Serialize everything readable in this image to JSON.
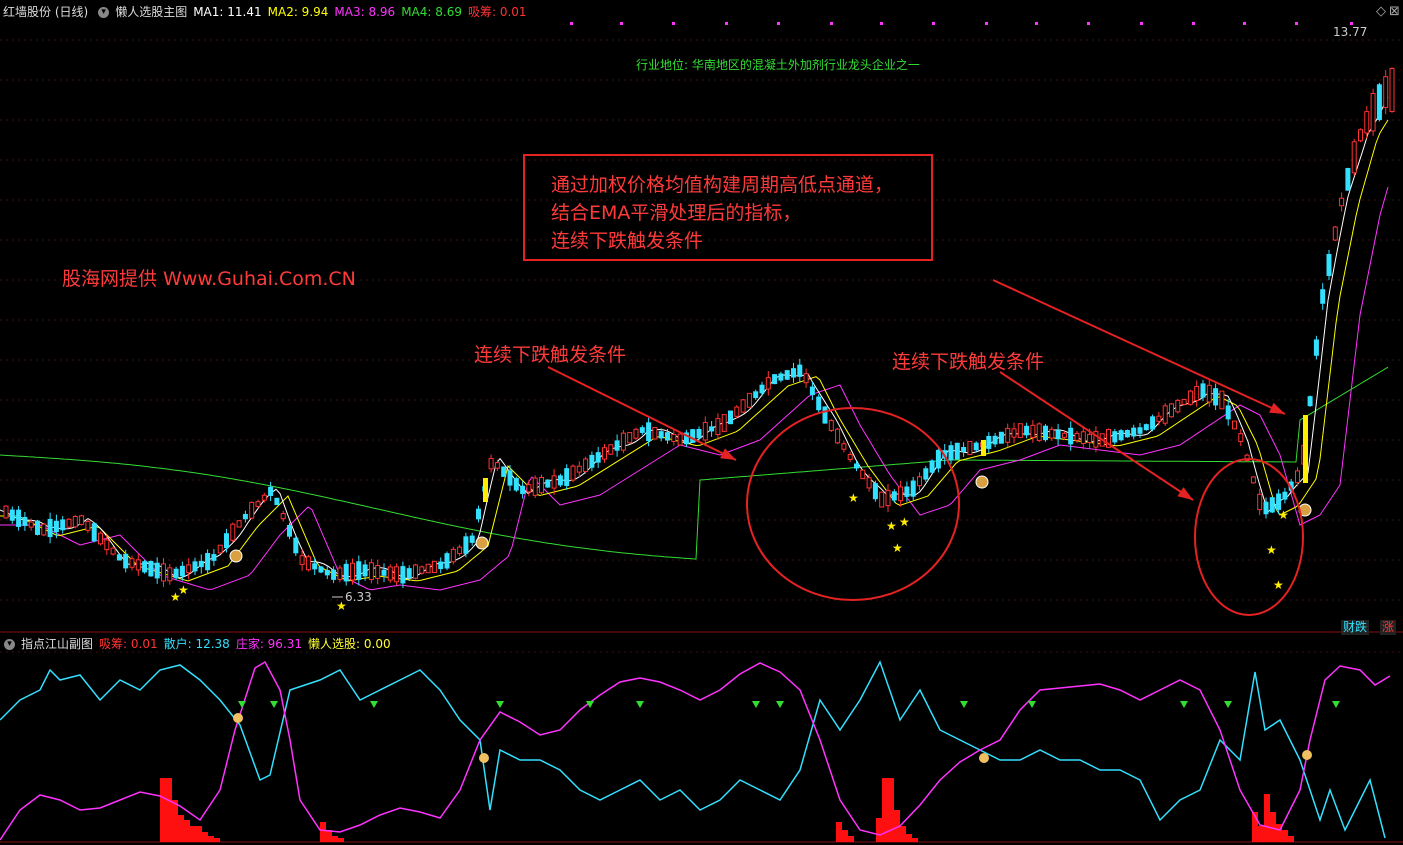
{
  "main_header": {
    "stock": "红墙股份 (日线)",
    "indicator": "懒人选股主图",
    "ma1": "MA1: 11.41",
    "ma2": "MA2: 9.94",
    "ma3": "MA3: 8.96",
    "ma4": "MA4: 8.69",
    "chip": "吸筹: 0.01"
  },
  "sub_header": {
    "indicator": "指点江山副图",
    "chip": "吸筹: 0.01",
    "retail": "散户: 12.38",
    "banker": "庄家: 96.31",
    "lazy": "懒人选股: 0.00"
  },
  "annotations": {
    "industry": "行业地位: 华南地区的混凝土外加剂行业龙头企业之一",
    "source": "股海网提供 Www.Guhai.Com.CN",
    "box_line1": "通过加权价格均值构建周期高低点通道，",
    "box_line2": "结合EMA平滑处理后的指标，",
    "box_line3": "连续下跌触发条件",
    "trigger1": "连续下跌触发条件",
    "trigger2": "连续下跌触发条件"
  },
  "price_labels": {
    "high": "13.77",
    "low": "6.33"
  },
  "badges": {
    "finance": "财跌",
    "rise": "涨"
  },
  "colors": {
    "ma1": "#ffffff",
    "ma2": "#ffff00",
    "ma3": "#ff33ff",
    "ma4": "#33dd33",
    "up": "#ff3333",
    "down": "#33e0ff",
    "annot": "#ff3a3a"
  }
}
